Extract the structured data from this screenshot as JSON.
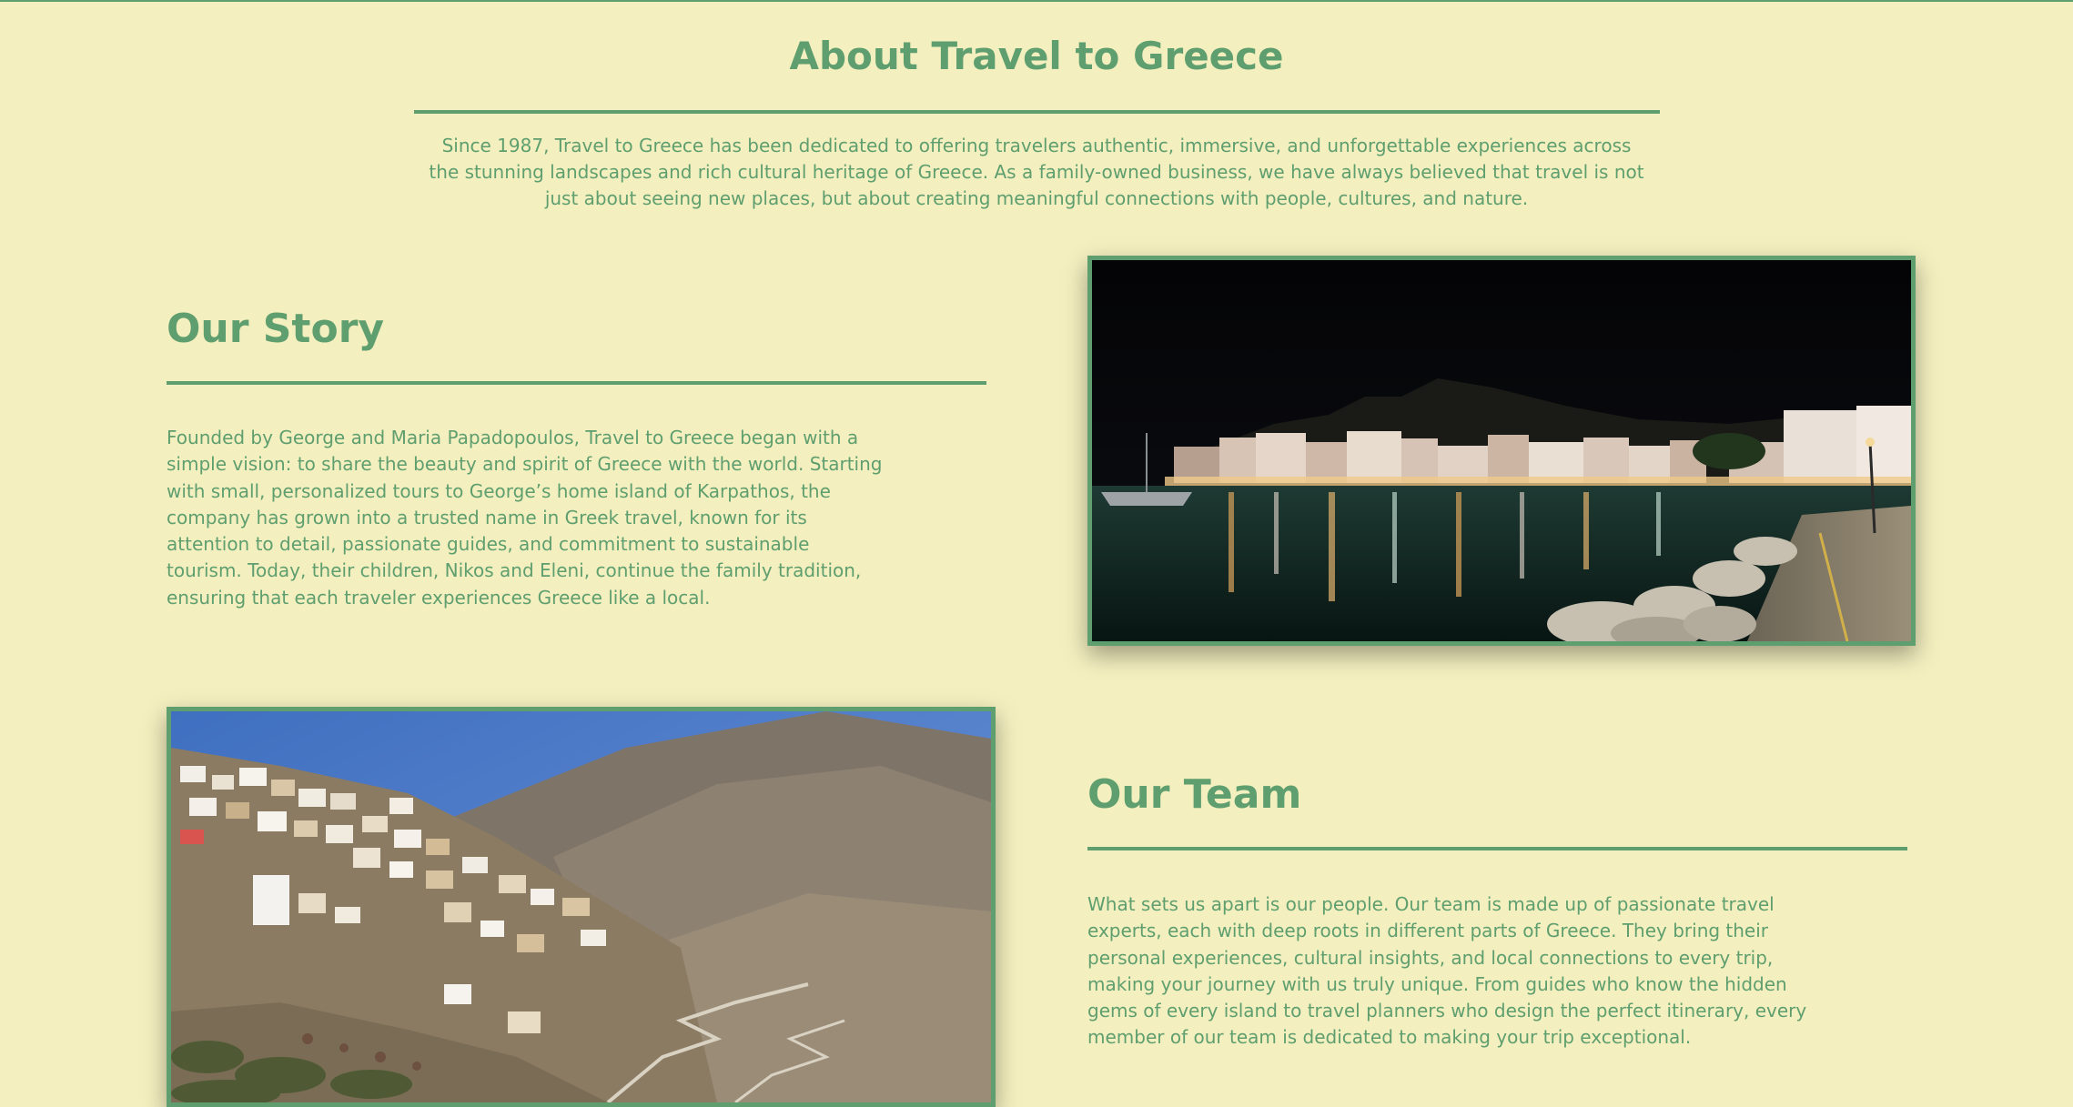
{
  "page": {
    "title": "About Travel to Greece",
    "intro": "Since 1987, Travel to Greece has been dedicated to offering travelers authentic, immersive, and unforgettable experiences across the stunning landscapes and rich cultural heritage of Greece. As a family-owned business, we have always believed that travel is not just about seeing new places, but about creating meaningful connections with people, cultures, and nature."
  },
  "story": {
    "heading": "Our Story",
    "text": "Founded by George and Maria Papadopoulos, Travel to Greece began with a simple vision: to share the beauty and spirit of Greece with the world. Starting with small, personalized tours to George’s home island of Karpathos, the company has grown into a trusted name in Greek travel, known for its attention to detail, passionate guides, and commitment to sustainable tourism. Today, their children, Nikos and Eleni, continue the family tradition, ensuring that each traveler experiences Greece like a local."
  },
  "team": {
    "heading": "Our Team",
    "text": "What sets us apart is our people. Our team is made up of passionate travel experts, each with deep roots in different parts of Greece. They bring their personal experiences, cultural insights, and local connections to every trip, making your journey with us truly unique. From guides who know the hidden gems of every island to travel planners who design the perfect itinerary, every member of our team is dedicated to making your trip exceptional."
  },
  "colors": {
    "background": "#f3efbf",
    "accent": "#5f9e6e"
  }
}
